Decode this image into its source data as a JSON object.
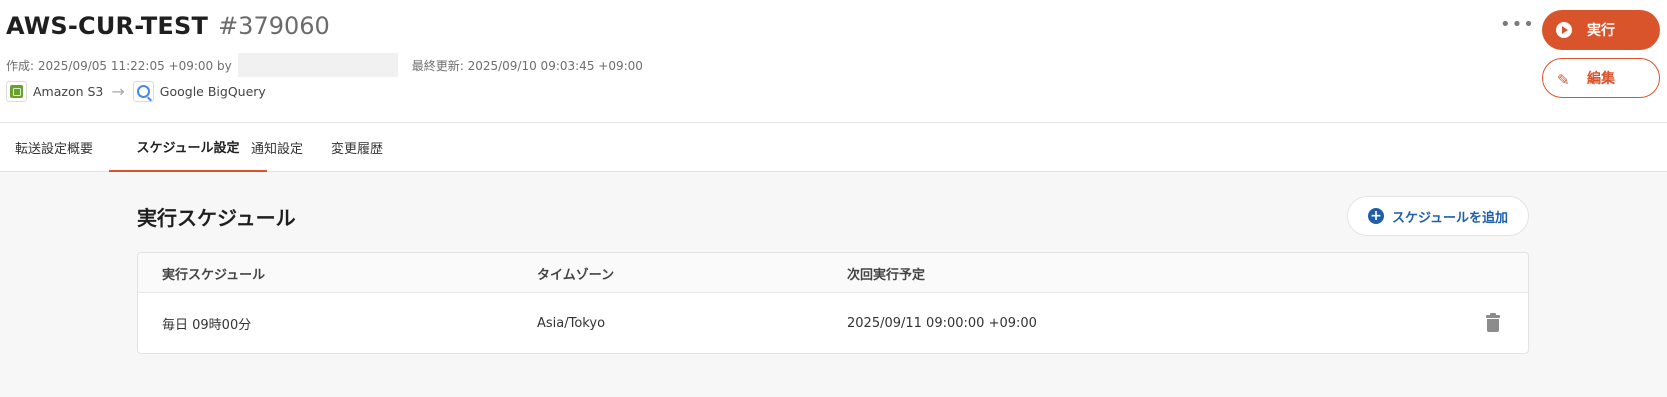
{
  "header": {
    "title": "AWS-CUR-TEST",
    "job_id": "#379060",
    "created": "作成: 2025/09/05 11:22:05 +09:00 by",
    "updated": "最終更新: 2025/09/10 09:03:45 +09:00",
    "source": {
      "label": "Amazon S3",
      "icon": "amazon-s3-icon"
    },
    "arrow": "→",
    "destination": {
      "label": "Google BigQuery",
      "icon": "google-bigquery-icon"
    },
    "more_label": "•••",
    "run_label": "実行",
    "edit_label": "編集",
    "accent_color": "#d9532b"
  },
  "tabs": [
    {
      "label": "転送設定概要",
      "active": false
    },
    {
      "label": "スケジュール設定",
      "active": true
    },
    {
      "label": "通知設定",
      "active": false
    },
    {
      "label": "変更履歴",
      "active": false
    }
  ],
  "schedule": {
    "section_title": "実行スケジュール",
    "add_label": "スケジュールを追加",
    "columns": [
      "実行スケジュール",
      "タイムゾーン",
      "次回実行予定"
    ],
    "rows": [
      {
        "schedule": "毎日 09時00分",
        "timezone": "Asia/Tokyo",
        "next_run": "2025/09/11 09:00:00 +09:00"
      }
    ]
  }
}
